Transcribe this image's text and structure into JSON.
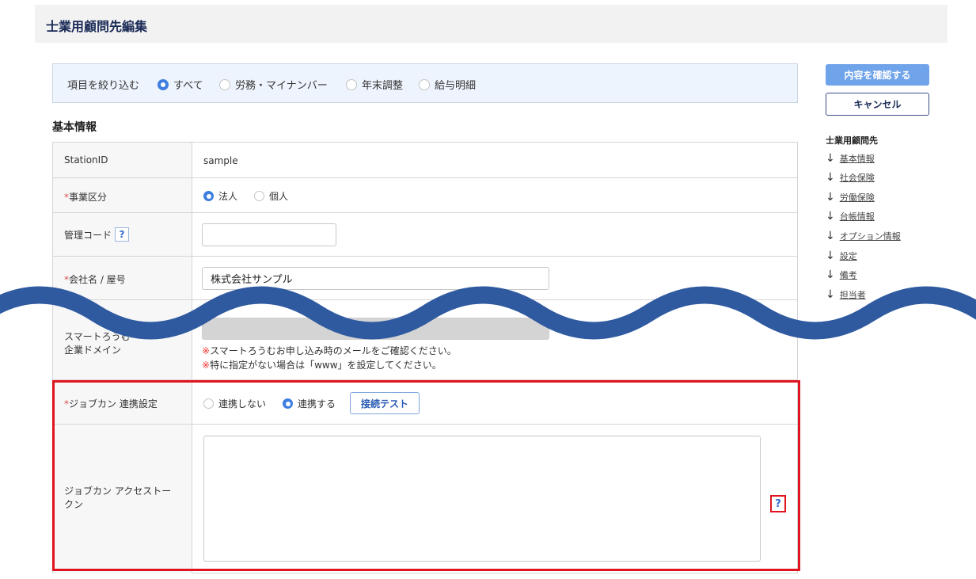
{
  "page": {
    "title": "士業用顧問先編集"
  },
  "filter": {
    "label": "項目を絞り込む",
    "options": [
      {
        "label": "すべて",
        "selected": true
      },
      {
        "label": "労務・マイナンバー",
        "selected": false
      },
      {
        "label": "年末調整",
        "selected": false
      },
      {
        "label": "給与明細",
        "selected": false
      }
    ]
  },
  "section": {
    "title": "基本情報"
  },
  "form": {
    "station_id": {
      "label": "StationID",
      "value": "sample"
    },
    "business_type": {
      "required_mark": "*",
      "label": "事業区分",
      "options": [
        {
          "label": "法人",
          "selected": true
        },
        {
          "label": "個人",
          "selected": false
        }
      ]
    },
    "management_code": {
      "label": "管理コード",
      "help": "?",
      "value": ""
    },
    "company_name": {
      "required_mark": "*",
      "label": "会社名 / 屋号",
      "value": "株式会社サンプル"
    },
    "smart_domain": {
      "label_line1": "スマートろうむ",
      "label_line2": "企業ドメイン",
      "value": "",
      "note_mark": "※",
      "note1": "スマートろうむお申し込み時のメールをご確認ください。",
      "note2": "特に指定がない場合は「www」を設定してください。"
    },
    "jobcan_link": {
      "required_mark": "*",
      "label": "ジョブカン 連携設定",
      "options": [
        {
          "label": "連携しない",
          "selected": false
        },
        {
          "label": "連携する",
          "selected": true
        }
      ],
      "test_button": "接続テスト"
    },
    "jobcan_token": {
      "label_line1": "ジョブカン アクセストー",
      "label_line2": "クン",
      "value": "",
      "help": "?"
    }
  },
  "actions": {
    "confirm": "内容を確認する",
    "cancel": "キャンセル"
  },
  "anchors": {
    "title": "士業用顧問先",
    "items": [
      {
        "label": "基本情報"
      },
      {
        "label": "社会保険"
      },
      {
        "label": "労働保険"
      },
      {
        "label": "台帳情報"
      },
      {
        "label": "オプション情報"
      },
      {
        "label": "設定"
      },
      {
        "label": "備考"
      },
      {
        "label": "担当者"
      }
    ]
  },
  "colors": {
    "accent": "#3d7ee0",
    "wave": "#2f5aa0",
    "highlight": "#e0141e",
    "header_text": "#1a2a56"
  }
}
